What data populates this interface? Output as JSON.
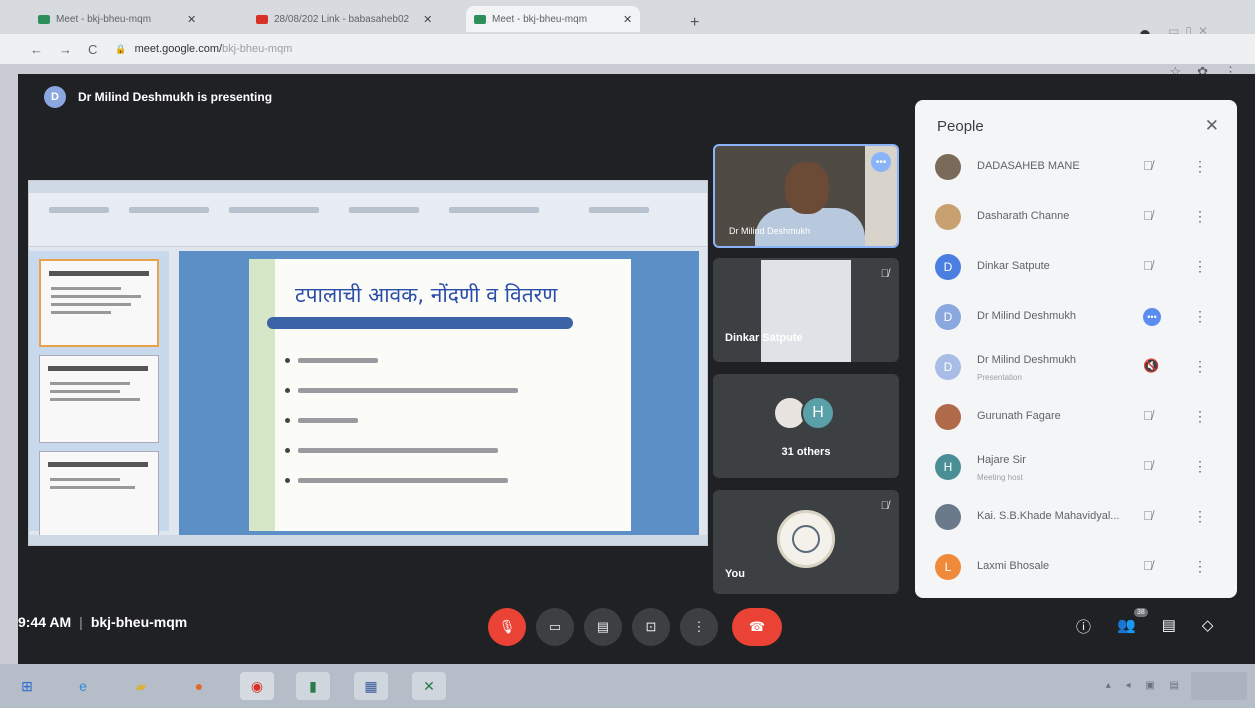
{
  "browser": {
    "tabs": [
      {
        "label": "Meet - bkj-bheu-mqm",
        "active": false
      },
      {
        "label": "28/08/202 Link - babasaheb02",
        "active": false
      },
      {
        "label": "Meet - bkj-bheu-mqm",
        "active": true
      }
    ],
    "url_host": "meet.google.com/",
    "url_path": "bkj-bheu-mqm"
  },
  "meet": {
    "presenter_initial": "D",
    "presenting_text": "Dr Milind Deshmukh is presenting",
    "time": "9:44 AM",
    "meeting_code": "bkj-bheu-mqm",
    "participant_badge": "38"
  },
  "slide": {
    "title": "टपालाची आवक, नोंदणी व वितरण"
  },
  "tiles": {
    "camera_name": "Dr Milind Deshmukh",
    "dinkar_name": "Dinkar Satpute",
    "others_initial": "H",
    "others_count": "31 others",
    "you_label": "You"
  },
  "people": {
    "header": "People",
    "rows": [
      {
        "name": "DADASAHEB MANE",
        "sub": "",
        "initial": "",
        "color": "#7a6a5a"
      },
      {
        "name": "Dasharath Channe",
        "sub": "",
        "initial": "",
        "color": "#c9a070"
      },
      {
        "name": "Dinkar Satpute",
        "sub": "",
        "initial": "D",
        "color": "#4a7ee0"
      },
      {
        "name": "Dr Milind Deshmukh",
        "sub": "",
        "initial": "D",
        "color": "#8aa7e0"
      },
      {
        "name": "Dr Milind Deshmukh",
        "sub": "Presentation",
        "initial": "D",
        "color": "#a9bce6"
      },
      {
        "name": "Gurunath Fagare",
        "sub": "",
        "initial": "",
        "color": "#b06a4a"
      },
      {
        "name": "Hajare Sir",
        "sub": "Meeting host",
        "initial": "H",
        "color": "#4a8f96"
      },
      {
        "name": "Kai. S.B.Khade Mahavidyal...",
        "sub": "",
        "initial": "",
        "color": "#6a7a8a"
      },
      {
        "name": "Laxmi Bhosale",
        "sub": "",
        "initial": "L",
        "color": "#ef8a3a"
      }
    ]
  },
  "colors": {
    "meet_bg": "#1f2124",
    "end_call": "#ea4335",
    "accent": "#8ab4f8"
  }
}
